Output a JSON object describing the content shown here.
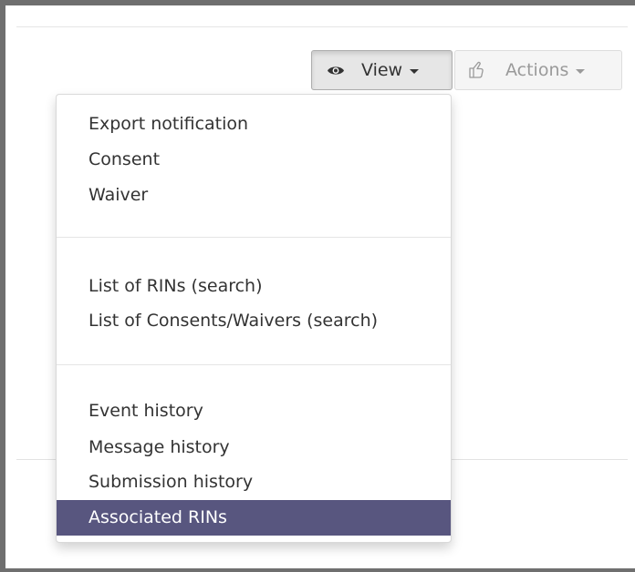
{
  "toolbar": {
    "view_label": "View",
    "actions_label": "Actions",
    "view_icon": "eye-icon",
    "actions_icon": "hand-pointer-icon"
  },
  "menu": {
    "groups": [
      [
        "Export notification",
        "Consent",
        "Waiver"
      ],
      [
        "List of RINs (search)",
        "List of Consents/Waivers (search)"
      ],
      [
        "Event history",
        "Message history",
        "Submission history",
        "Associated RINs"
      ]
    ],
    "active_item": "Associated RINs"
  },
  "colors": {
    "active_bg": "#58567f",
    "active_text": "#ffffff",
    "frame_border": "#6f6f6f",
    "button_bg": "#e6e6e6"
  }
}
